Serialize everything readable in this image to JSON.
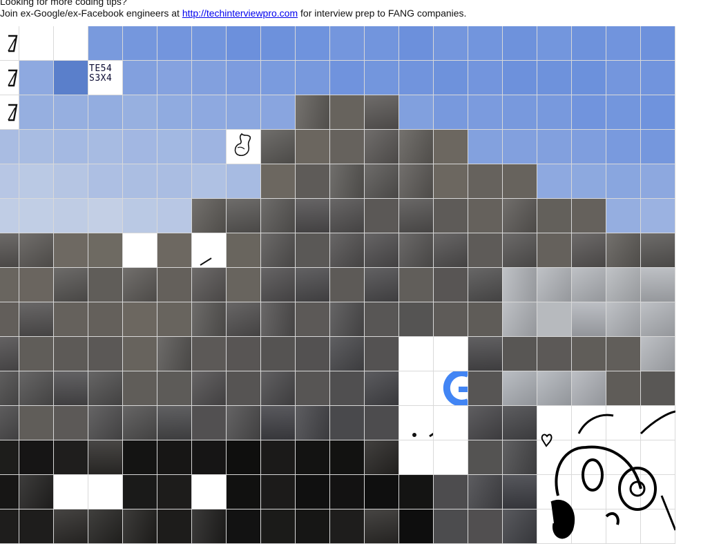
{
  "banner": {
    "line1": "Looking for more coding tips?",
    "line2_prefix": "Join ex-Google/ex-Facebook engineers at",
    "link_text": "http://techinterviewpro.com",
    "line2_suffix": "for interview prep to FANG companies."
  },
  "captcha_text": {
    "line1": "TE54",
    "line2": "S3X4"
  },
  "colors": {
    "sky": "#6a8fdc",
    "cloud": "#cfd8e6",
    "rock": "#6f6a62",
    "rock_dark": "#3e3f45",
    "shadow": "#0d0d0d",
    "snow": "#e8eef6",
    "google_blue": "#4285f4"
  }
}
